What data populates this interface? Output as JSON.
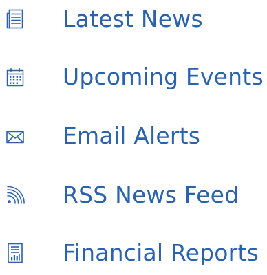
{
  "colors": {
    "accent": "#2a62ad",
    "icon": "#2a62ad",
    "background": "#ffffff"
  },
  "menu": {
    "items": [
      {
        "label": "Latest News",
        "icon": "news-icon"
      },
      {
        "label": "Upcoming Events",
        "icon": "calendar-icon"
      },
      {
        "label": "Email Alerts",
        "icon": "envelope-icon"
      },
      {
        "label": "RSS News Feed",
        "icon": "rss-icon"
      },
      {
        "label": "Financial Reports",
        "icon": "report-chart-icon"
      }
    ]
  }
}
